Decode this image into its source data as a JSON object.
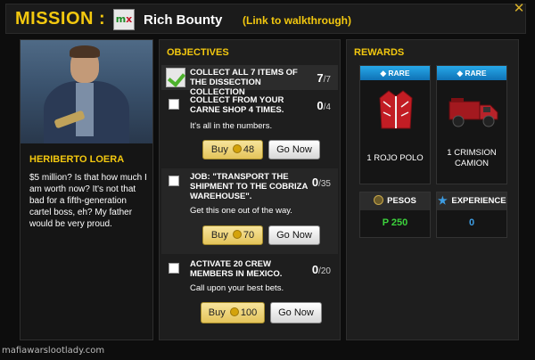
{
  "header": {
    "mission_label": "MISSION :",
    "mission_icon_text": "mx",
    "mission_title": "Rich Bounty",
    "walkthrough_link": "(Link to walkthrough)"
  },
  "character": {
    "name": "HERIBERTO LOERA",
    "bio": "$5 million? Is that how much I am worth now? It's not that bad for a fifth-generation cartel boss, eh? My father would be very proud."
  },
  "objectives": {
    "title": "OBJECTIVES",
    "items": [
      {
        "text": "COLLECT ALL 7 ITEMS OF THE DISSECTION COLLECTION",
        "done": "7",
        "total": "/7",
        "completed": true
      },
      {
        "text": "COLLECT FROM YOUR CARNE SHOP 4 TIMES.",
        "done": "0",
        "total": "/4",
        "hint": "It's all in the numbers.",
        "buy_label": "Buy",
        "buy_cost": "48",
        "go_label": "Go Now"
      },
      {
        "text": "JOB: \"TRANSPORT THE SHIPMENT TO THE COBRIZA WAREHOUSE\".",
        "done": "0",
        "total": "/35",
        "hint": "Get this one out of the way.",
        "buy_label": "Buy",
        "buy_cost": "70",
        "go_label": "Go Now"
      },
      {
        "text": "ACTIVATE 20 CREW MEMBERS IN MEXICO.",
        "done": "0",
        "total": "/20",
        "hint": "Call upon your best bets.",
        "buy_label": "Buy",
        "buy_cost": "100",
        "go_label": "Go Now"
      }
    ]
  },
  "rewards": {
    "title": "REWARDS",
    "items": [
      {
        "rarity": "RARE",
        "name": "1 ROJO POLO",
        "icon": "jacket-icon"
      },
      {
        "rarity": "RARE",
        "name": "1 CRIMSION CAMION",
        "icon": "truck-icon"
      }
    ],
    "pesos_label": "PESOS",
    "pesos_value": "P 250",
    "experience_label": "EXPERIENCE",
    "experience_value": "0"
  },
  "watermark": "mafiawarslootlady.com",
  "colors": {
    "accent_gold": "#f3c80f",
    "rare_blue": "#1b8fd4",
    "pesos_green": "#3cd23c",
    "xp_blue": "#3d9de3"
  }
}
